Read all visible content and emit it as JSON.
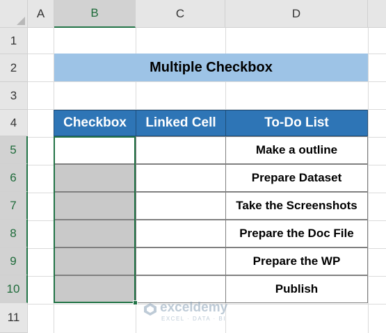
{
  "columns": [
    "A",
    "B",
    "C",
    "D"
  ],
  "rows": [
    "1",
    "2",
    "3",
    "4",
    "5",
    "6",
    "7",
    "8",
    "9",
    "10",
    "11"
  ],
  "title": "Multiple Checkbox",
  "table": {
    "headers": [
      "Checkbox",
      "Linked Cell",
      "To-Do List"
    ],
    "todo_items": [
      "Make a outline",
      "Prepare Dataset",
      "Take the Screenshots",
      "Prepare the Doc File",
      "Prepare the WP",
      "Publish"
    ]
  },
  "watermark": {
    "name": "exceldemy",
    "tagline": "EXCEL · DATA · BI"
  },
  "colors": {
    "header_fill": "#2e75b6",
    "title_fill": "#9dc3e6",
    "selection": "#217346",
    "grey_cell": "#c9c9c9"
  }
}
